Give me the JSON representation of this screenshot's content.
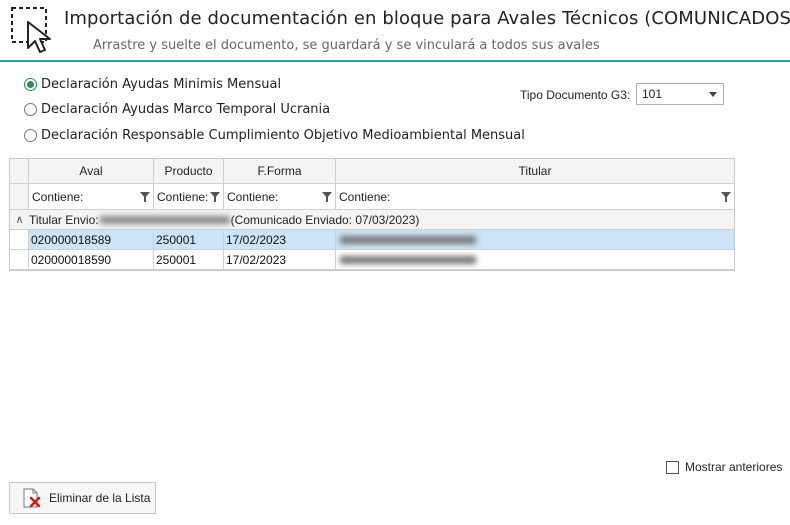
{
  "header": {
    "title": "Importación de documentación en bloque para Avales Técnicos (COMUNICADOS)",
    "subtitle": "Arrastre y suelte el documento, se guardará y se vinculará a todos sus avales",
    "icon": "drag-drop-cursor-icon",
    "accent_color": "#2a9db0"
  },
  "options": {
    "selected_index": 0,
    "items": [
      {
        "label": "Declaración Ayudas Minimis Mensual"
      },
      {
        "label": "Declaración Ayudas Marco Temporal Ucrania"
      },
      {
        "label": "Declaración Responsable Cumplimiento Objetivo Medioambiental Mensual"
      }
    ]
  },
  "tipo_documento": {
    "label": "Tipo Documento G3:",
    "value": "101"
  },
  "grid": {
    "columns": [
      {
        "label": "Aval"
      },
      {
        "label": "Producto"
      },
      {
        "label": "F.Forma"
      },
      {
        "label": "Titular"
      }
    ],
    "filter_text": "Contiene:",
    "group": {
      "prefix": "Titular Envio: ",
      "suffix": " (Comunicado Enviado: 07/03/2023)"
    },
    "rows": [
      {
        "aval": "020000018589",
        "producto": "250001",
        "fforma": "17/02/2023",
        "selected": true
      },
      {
        "aval": "020000018590",
        "producto": "250001",
        "fforma": "17/02/2023",
        "selected": false
      }
    ],
    "selection_color": "#cce4f7"
  },
  "mostrar_anteriores": {
    "label": "Mostrar anteriores",
    "checked": false
  },
  "delete_button": {
    "label": "Eliminar de la Lista",
    "icon": "delete-document-icon"
  }
}
